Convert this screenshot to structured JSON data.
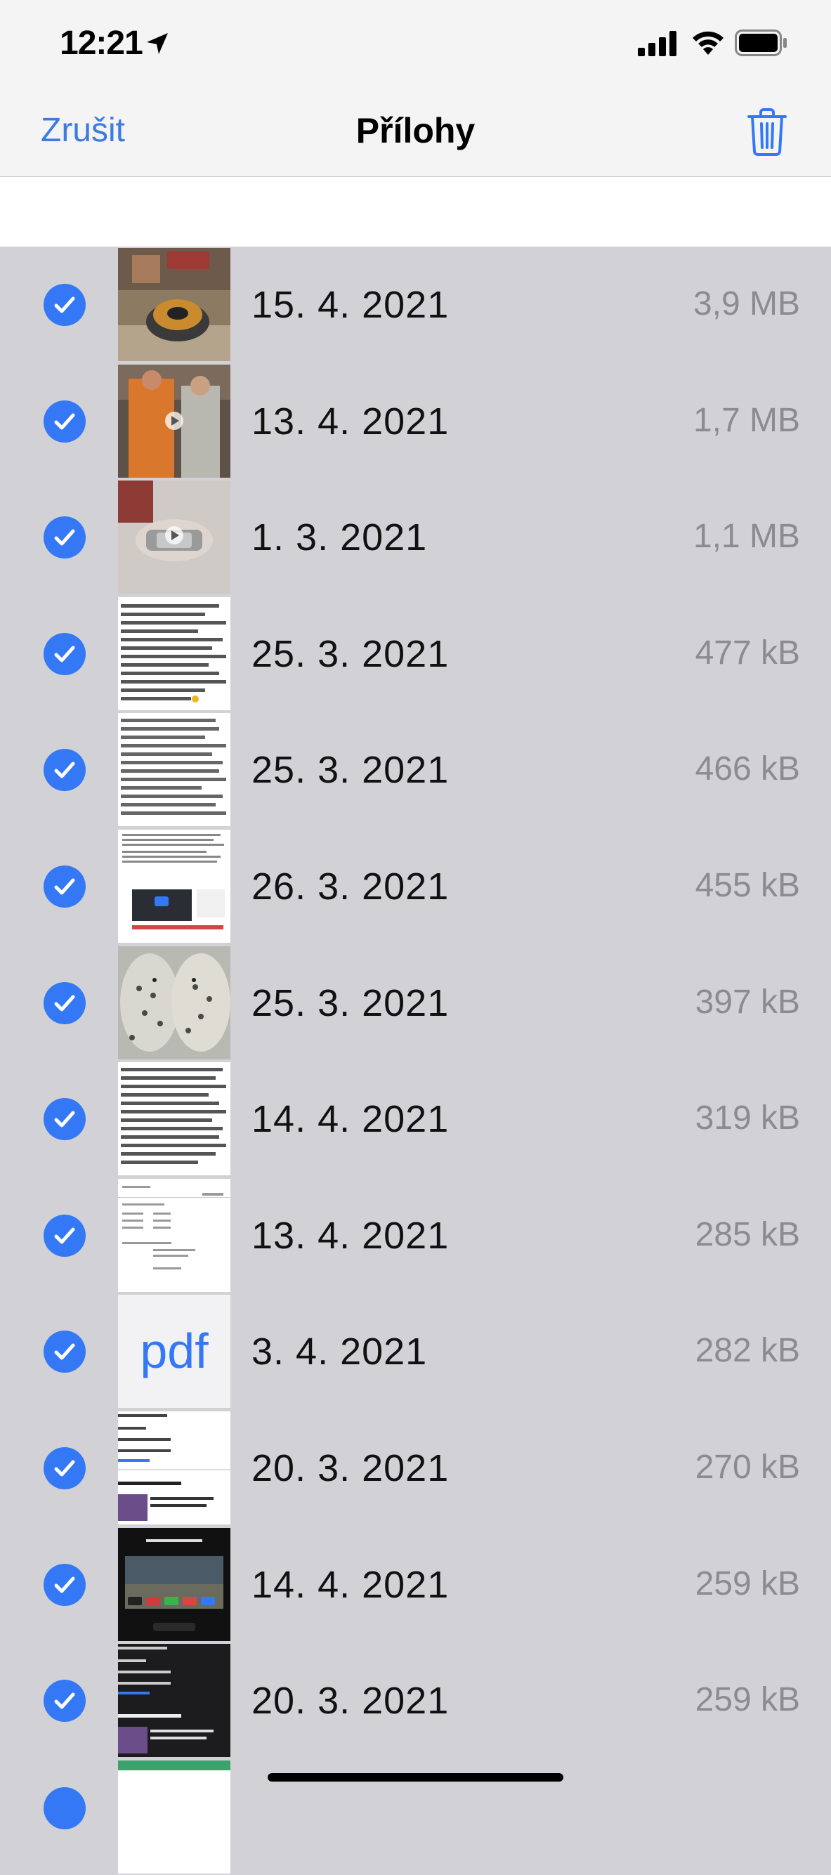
{
  "status_bar": {
    "time": "12:21"
  },
  "nav": {
    "cancel_label": "Zrušit",
    "title": "Přílohy"
  },
  "attachments": [
    {
      "date": "15. 4. 2021",
      "size": "3,9 MB",
      "thumb": "photo-shopping-cart"
    },
    {
      "date": "13. 4. 2021",
      "size": "1,7 MB",
      "thumb": "video-orange-suit"
    },
    {
      "date": "1. 3. 2021",
      "size": "1,1 MB",
      "thumb": "video-watch-wrist"
    },
    {
      "date": "25. 3. 2021",
      "size": "477 kB",
      "thumb": "text-screenshot"
    },
    {
      "date": "25. 3. 2021",
      "size": "466 kB",
      "thumb": "text-screenshot"
    },
    {
      "date": "26. 3. 2021",
      "size": "455 kB",
      "thumb": "web-screenshot"
    },
    {
      "date": "25. 3. 2021",
      "size": "397 kB",
      "thumb": "photo-snow-leopards"
    },
    {
      "date": "14. 4. 2021",
      "size": "319 kB",
      "thumb": "text-screenshot"
    },
    {
      "date": "13. 4. 2021",
      "size": "285 kB",
      "thumb": "document-screenshot"
    },
    {
      "date": "3. 4. 2021",
      "size": "282 kB",
      "thumb": "pdf",
      "thumb_label": "pdf"
    },
    {
      "date": "20. 3. 2021",
      "size": "270 kB",
      "thumb": "stats-screenshot-light"
    },
    {
      "date": "14. 4. 2021",
      "size": "259 kB",
      "thumb": "apple-tv-ad"
    },
    {
      "date": "20. 3. 2021",
      "size": "259 kB",
      "thumb": "stats-screenshot-dark"
    }
  ],
  "colors": {
    "accent": "#3478f6",
    "row_bg": "#d1d1d6",
    "size_text": "#8b8b90"
  }
}
